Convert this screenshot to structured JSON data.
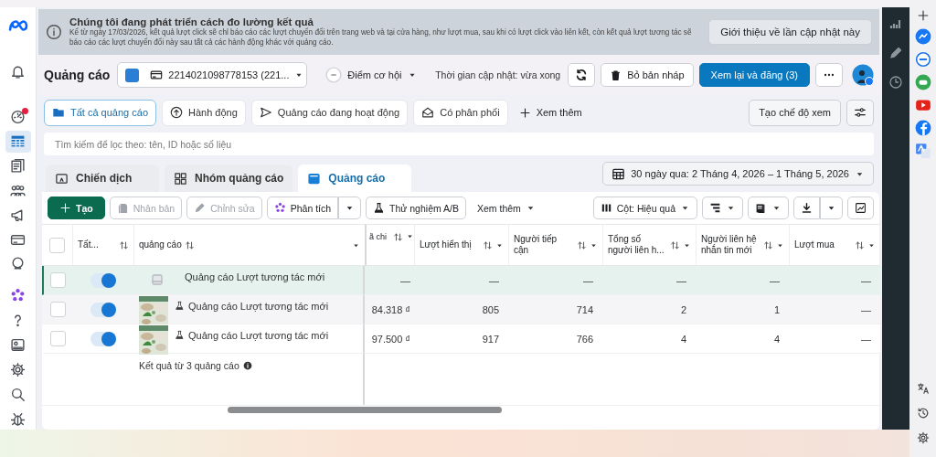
{
  "banner": {
    "title": "Chúng tôi đang phát triển cách đo lường kết quả",
    "body": "Kể từ ngày 17/03/2026, kết quả lượt click sẽ chỉ báo cáo các lượt chuyển đổi trên trang web và tại cửa hàng, như lượt mua, sau khi có lượt click vào liên kết, còn kết quả lượt tương tác sẽ báo cáo các lượt chuyển đổi này sau tất cả các hành động khác với quảng cáo.",
    "button": "Giới thiệu về lần cập nhật này"
  },
  "nav": [
    {
      "selected": false,
      "badge": false
    },
    {
      "selected": false,
      "badge": true
    },
    {
      "selected": true,
      "badge": false
    },
    {
      "selected": false,
      "badge": false
    },
    {
      "selected": false,
      "badge": false
    },
    {
      "selected": false,
      "badge": false
    },
    {
      "selected": false,
      "badge": false
    },
    {
      "selected": false,
      "badge": false
    },
    {
      "selected": false,
      "badge": false
    },
    {
      "selected": false,
      "badge": false
    },
    {
      "selected": false,
      "badge": false
    },
    {
      "selected": false,
      "badge": false
    },
    {
      "selected": false,
      "badge": false
    },
    {
      "selected": false,
      "badge": false
    }
  ],
  "header": {
    "title": "Quảng cáo",
    "account": "2214021098778153 (221...",
    "opportunity": "Điểm cơ hội",
    "updated": "Thời gian cập nhật: vừa xong",
    "discard": "Bỏ bản nháp",
    "publish": "Xem lại và đăng (3)"
  },
  "filters": [
    {
      "label": "Tất cả quảng cáo",
      "selected": true
    },
    {
      "label": "Hành động",
      "selected": false
    },
    {
      "label": "Quảng cáo đang hoạt động",
      "selected": false
    },
    {
      "label": "Có phân phối",
      "selected": false
    }
  ],
  "filters_more": "Xem thêm",
  "view_button": "Tạo chế độ xem",
  "search": {
    "placeholder": "Tìm kiếm để lọc theo: tên, ID hoặc số liệu"
  },
  "levels": [
    {
      "label": "Chiến dịch",
      "selected": false
    },
    {
      "label": "Nhóm quảng cáo",
      "selected": false
    },
    {
      "label": "Quảng cáo",
      "selected": true
    }
  ],
  "date_range": "30 ngày qua: 2 Tháng 4, 2026 – 1 Tháng 5, 2026",
  "toolbar": [
    {
      "label": "Tạo",
      "kind": "primary",
      "disabled": false
    },
    {
      "label": "Nhân bản",
      "kind": "button",
      "disabled": true
    },
    {
      "label": "Chỉnh sửa",
      "kind": "button",
      "disabled": true
    },
    {
      "label": "Phân tích",
      "kind": "split",
      "disabled": false
    },
    {
      "label": "Thử nghiệm A/B",
      "kind": "button",
      "disabled": false
    },
    {
      "label": "Xem thêm",
      "kind": "menu",
      "disabled": false
    }
  ],
  "columns_button": "Cột: Hiệu quả",
  "table": {
    "select_all_checked": false,
    "frozen_columns": [
      "Tất...",
      "quảng cáo"
    ],
    "columns": [
      "ã chi",
      "Lượt hiển thị",
      "Người tiếp cận",
      "Tổng số người liên h...",
      "Người liên hệ nhắn tin mới",
      "Lượt mua"
    ],
    "rows": [
      {
        "kind": "draft",
        "highlighted": true,
        "checked": false,
        "on": true,
        "name": "Quảng cáo Lượt tương tác mới",
        "cells": [
          "—",
          "—",
          "—",
          "—",
          "—",
          "—"
        ]
      },
      {
        "kind": "ad",
        "highlighted": false,
        "checked": false,
        "on": true,
        "name": "Quảng cáo Lượt tương tác mới",
        "cells": [
          "84.318 ₫",
          "805",
          "714",
          "2",
          "1",
          "—"
        ]
      },
      {
        "kind": "ad",
        "highlighted": false,
        "checked": false,
        "on": true,
        "name": "Quảng cáo Lượt tương tác mới",
        "cells": [
          "97.500 ₫",
          "917",
          "766",
          "4",
          "4",
          "—"
        ]
      }
    ],
    "footer": "Kết quả từ 3 quảng cáo"
  }
}
